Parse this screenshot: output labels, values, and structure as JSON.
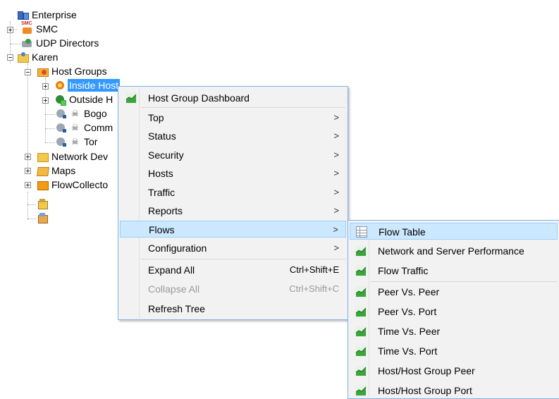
{
  "tree": {
    "enterprise": "Enterprise",
    "smc": "SMC",
    "udp_directors": "UDP Directors",
    "karen": "Karen",
    "host_groups": "Host Groups",
    "inside_hosts": "Inside Host",
    "outside_hosts": "Outside H",
    "bogon": "Bogo",
    "command": "Comm",
    "tor": "Tor",
    "network_devices": "Network Dev",
    "maps": "Maps",
    "flow_collectors": "FlowCollecto",
    "selected_node": "Inside Host"
  },
  "context_menu": {
    "items": [
      {
        "label": "Host Group Dashboard",
        "icon": "chart-icon"
      },
      {
        "label": "Top",
        "submenu": true
      },
      {
        "label": "Status",
        "submenu": true
      },
      {
        "label": "Security",
        "submenu": true
      },
      {
        "label": "Hosts",
        "submenu": true
      },
      {
        "label": "Traffic",
        "submenu": true
      },
      {
        "label": "Reports",
        "submenu": true
      },
      {
        "label": "Flows",
        "submenu": true,
        "highlighted": true
      },
      {
        "label": "Configuration",
        "submenu": true
      },
      {
        "label": "Expand All",
        "shortcut": "Ctrl+Shift+E"
      },
      {
        "label": "Collapse All",
        "shortcut": "Ctrl+Shift+C",
        "disabled": true
      },
      {
        "label": "Refresh Tree"
      }
    ],
    "arrow": ">"
  },
  "flows_submenu": {
    "items": [
      {
        "label": "Flow Table",
        "icon": "table-icon",
        "highlighted": true
      },
      {
        "label": "Network and Server Performance",
        "icon": "chart-icon"
      },
      {
        "label": "Flow Traffic",
        "icon": "chart-icon"
      },
      {
        "label": "Peer Vs. Peer",
        "icon": "chart-icon"
      },
      {
        "label": "Peer Vs. Port",
        "icon": "chart-icon"
      },
      {
        "label": "Time Vs. Peer",
        "icon": "chart-icon"
      },
      {
        "label": "Time Vs. Port",
        "icon": "chart-icon"
      },
      {
        "label": "Host/Host Group Peer",
        "icon": "chart-icon"
      },
      {
        "label": "Host/Host Group Port",
        "icon": "chart-icon"
      }
    ]
  },
  "colors": {
    "selection": "#3399ff",
    "menu_highlight": "#cce8ff",
    "menu_border": "#7fb4e8",
    "chart_icon_green": "#3aa53a"
  }
}
